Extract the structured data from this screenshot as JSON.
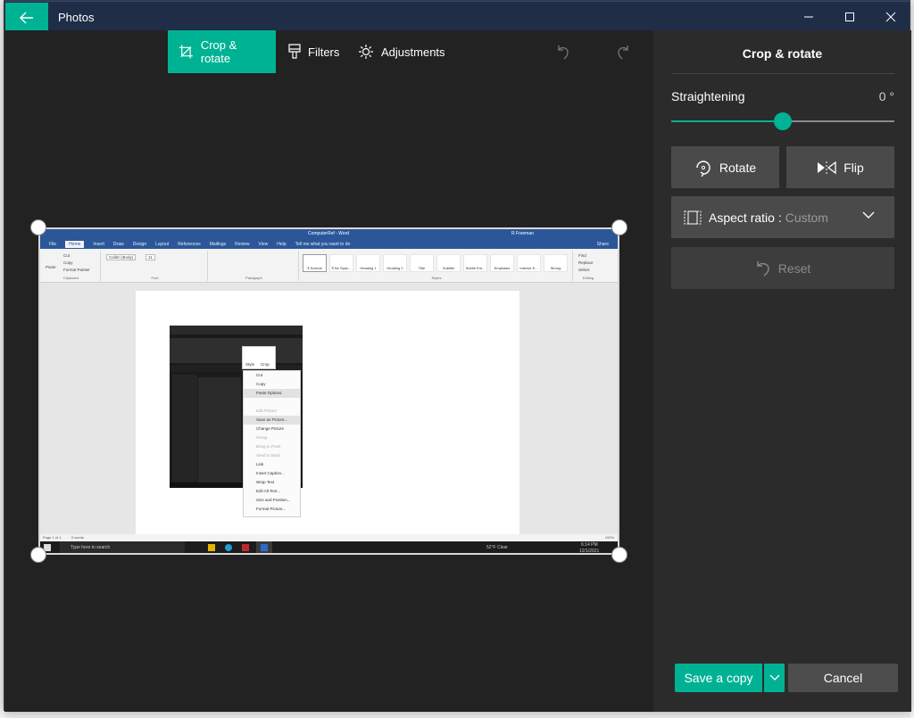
{
  "window": {
    "app_title": "Photos",
    "back_icon": "arrow-left-icon",
    "controls": [
      "minimize-icon",
      "maximize-icon",
      "close-icon"
    ]
  },
  "toolbar": {
    "tabs": [
      {
        "label": "Crop & rotate",
        "icon": "crop-icon",
        "active": true
      },
      {
        "label": "Filters",
        "icon": "filter-brush-icon",
        "active": false
      },
      {
        "label": "Adjustments",
        "icon": "brightness-icon",
        "active": false
      }
    ],
    "undo_icon": "undo-icon",
    "redo_icon": "redo-icon"
  },
  "photo": {
    "word_title": "ComputerRef - Word",
    "word_user": "R Freeman",
    "word_tabs": [
      "File",
      "Home",
      "Insert",
      "Draw",
      "Design",
      "Layout",
      "References",
      "Mailings",
      "Review",
      "View",
      "Help"
    ],
    "word_tell_me": "Tell me what you want to do",
    "word_share": "Share",
    "clipboard": {
      "paste": "Paste",
      "cut": "Cut",
      "copy": "Copy",
      "format_painter": "Format Painter",
      "group": "Clipboard"
    },
    "font": {
      "name": "Calibri (Body)",
      "size": "11",
      "group": "Font"
    },
    "paragraph_group": "Paragraph",
    "styles": [
      "¶ Normal",
      "¶ No Spac...",
      "Heading 1",
      "Heading 2",
      "Title",
      "Subtitle",
      "Subtle Em...",
      "Emphasis",
      "Intense E...",
      "Strong"
    ],
    "styles_group": "Styles",
    "editing": {
      "find": "Find",
      "replace": "Replace",
      "select": "Select",
      "group": "Editing"
    },
    "context_menu": [
      {
        "label": "Cut",
        "state": "normal"
      },
      {
        "label": "Copy",
        "state": "normal"
      },
      {
        "label": "Paste Options:",
        "state": "highlight"
      },
      {
        "label": "",
        "state": "normal"
      },
      {
        "label": "Edit Picture",
        "state": "disabled"
      },
      {
        "label": "Save as Picture...",
        "state": "highlight"
      },
      {
        "label": "Change Picture",
        "state": "normal"
      },
      {
        "label": "Group",
        "state": "disabled"
      },
      {
        "label": "Bring to Front",
        "state": "disabled"
      },
      {
        "label": "Send to Back",
        "state": "disabled"
      },
      {
        "label": "Link",
        "state": "normal"
      },
      {
        "label": "Insert Caption...",
        "state": "normal"
      },
      {
        "label": "Wrap Text",
        "state": "normal"
      },
      {
        "label": "Edit Alt Text...",
        "state": "normal"
      },
      {
        "label": "Size and Position...",
        "state": "normal"
      },
      {
        "label": "Format Picture...",
        "state": "normal"
      }
    ],
    "mini_toolbar": [
      "Style",
      "Crop"
    ],
    "status": {
      "page": "Page 1 of 1",
      "words": "0 words",
      "zoom": "100%"
    },
    "taskbar": {
      "search": "Type here to search",
      "weather": "52°F Clear",
      "time": "6:14 PM",
      "date": "12/1/2021"
    }
  },
  "panel": {
    "title": "Crop & rotate",
    "straightening_label": "Straightening",
    "straightening_value": "0 °",
    "straightening_fraction": 0.5,
    "rotate_label": "Rotate",
    "flip_label": "Flip",
    "aspect_label": "Aspect ratio :",
    "aspect_value": "Custom",
    "reset_label": "Reset",
    "save_label": "Save a copy",
    "cancel_label": "Cancel"
  },
  "colors": {
    "accent": "#00b294",
    "titlebar": "#1f2d47",
    "canvas": "#222222",
    "panel": "#2b2b2b",
    "button": "#4a4a4a"
  }
}
